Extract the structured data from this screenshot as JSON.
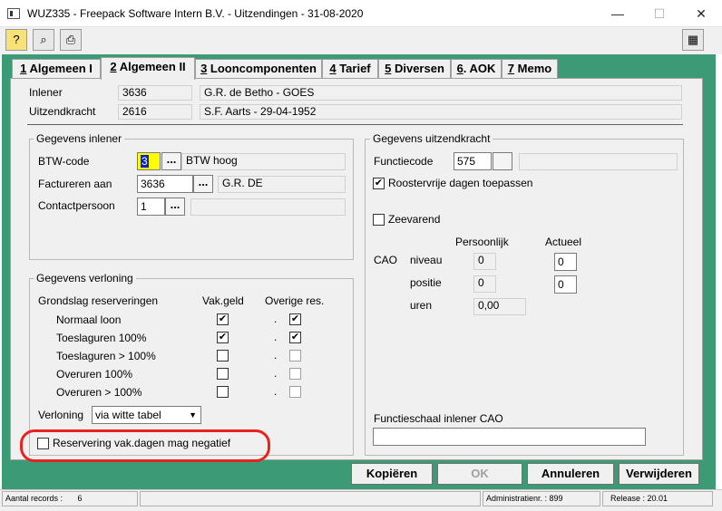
{
  "window": {
    "title": "WUZ335  -  Freepack Software Intern B.V.  -  Uitzendingen  -  31-08-2020",
    "minimize": "—",
    "maximize": "☐",
    "close": "✕"
  },
  "toolbar": {
    "help": "?",
    "binoculars": "⌕",
    "print": "⎙",
    "calculator": "▦"
  },
  "tabs": [
    {
      "num": "1",
      "label": "Algemeen I"
    },
    {
      "num": "2",
      "label": "Algemeen II"
    },
    {
      "num": "3",
      "label": "Looncomponenten"
    },
    {
      "num": "4",
      "label": "Tarief"
    },
    {
      "num": "5",
      "label": "Diversen"
    },
    {
      "num": "6",
      "label": ". AOK"
    },
    {
      "num": "7",
      "label": "Memo"
    }
  ],
  "header": {
    "inlener_label": "Inlener",
    "inlener_code": "3636",
    "inlener_name": "G.R. de Betho  -  GOES",
    "uitzendkracht_label": "Uitzendkracht",
    "uitzendkracht_code": "2616",
    "uitzendkracht_name": "S.F. Aarts  -  29-04-1952"
  },
  "inlener": {
    "title": "Gegevens inlener",
    "btw_label": "BTW-code",
    "btw_value": "3",
    "btw_desc": "BTW hoog",
    "factureren_label": "Factureren aan",
    "factureren_value": "3636",
    "factureren_desc": "G.R. DE",
    "contact_label": "Contactpersoon",
    "contact_value": "1",
    "contact_desc": "",
    "dots": "..."
  },
  "uitzendkracht": {
    "title": "Gegevens uitzendkracht",
    "functiecode_label": "Functiecode",
    "functiecode_value": "575",
    "functiecode_desc": "",
    "roostervrij_label": "Roostervrije dagen toepassen",
    "roostervrij_checked": true,
    "zeevarend_label": "Zeevarend",
    "zeevarend_checked": false,
    "persoonlijk": "Persoonlijk",
    "actueel": "Actueel",
    "cao": "CAO",
    "niveau": "niveau",
    "positie": "positie",
    "uren": "uren",
    "niveau_p": "0",
    "niveau_a": "0",
    "positie_p": "0",
    "positie_a": "0",
    "uren_p": "0,00",
    "schaal_label": "Functieschaal inlener CAO",
    "schaal_value": ""
  },
  "verloning": {
    "title": "Gegevens verloning",
    "grondslag": "Grondslag reserveringen",
    "vakgeld": "Vak.geld",
    "overige": "Overige res.",
    "rows": [
      {
        "label": "Normaal loon",
        "vak": true,
        "ov": true
      },
      {
        "label": "Toeslaguren 100%",
        "vak": true,
        "ov": true
      },
      {
        "label": "Toeslaguren > 100%",
        "vak": false,
        "ov": false
      },
      {
        "label": "Overuren 100%",
        "vak": false,
        "ov": false
      },
      {
        "label": "Overuren > 100%",
        "vak": false,
        "ov": false
      }
    ],
    "verloning_label": "Verloning",
    "verloning_value": "via witte tabel",
    "negatief_label": "Reservering vak.dagen mag negatief",
    "negatief_checked": false
  },
  "buttons": {
    "kopieren": "Kopiëren",
    "ok": "OK",
    "annuleren": "Annuleren",
    "verwijderen": "Verwijderen"
  },
  "status": {
    "records_label": "Aantal records :",
    "records_value": "6",
    "admin": "Administratienr. : 899",
    "release": "Release : 20.01"
  },
  "colors": {
    "client_bg": "#3d9a77",
    "highlight": "#ffff00",
    "selection": "#0a24c8",
    "annotation": "#e8231f"
  }
}
